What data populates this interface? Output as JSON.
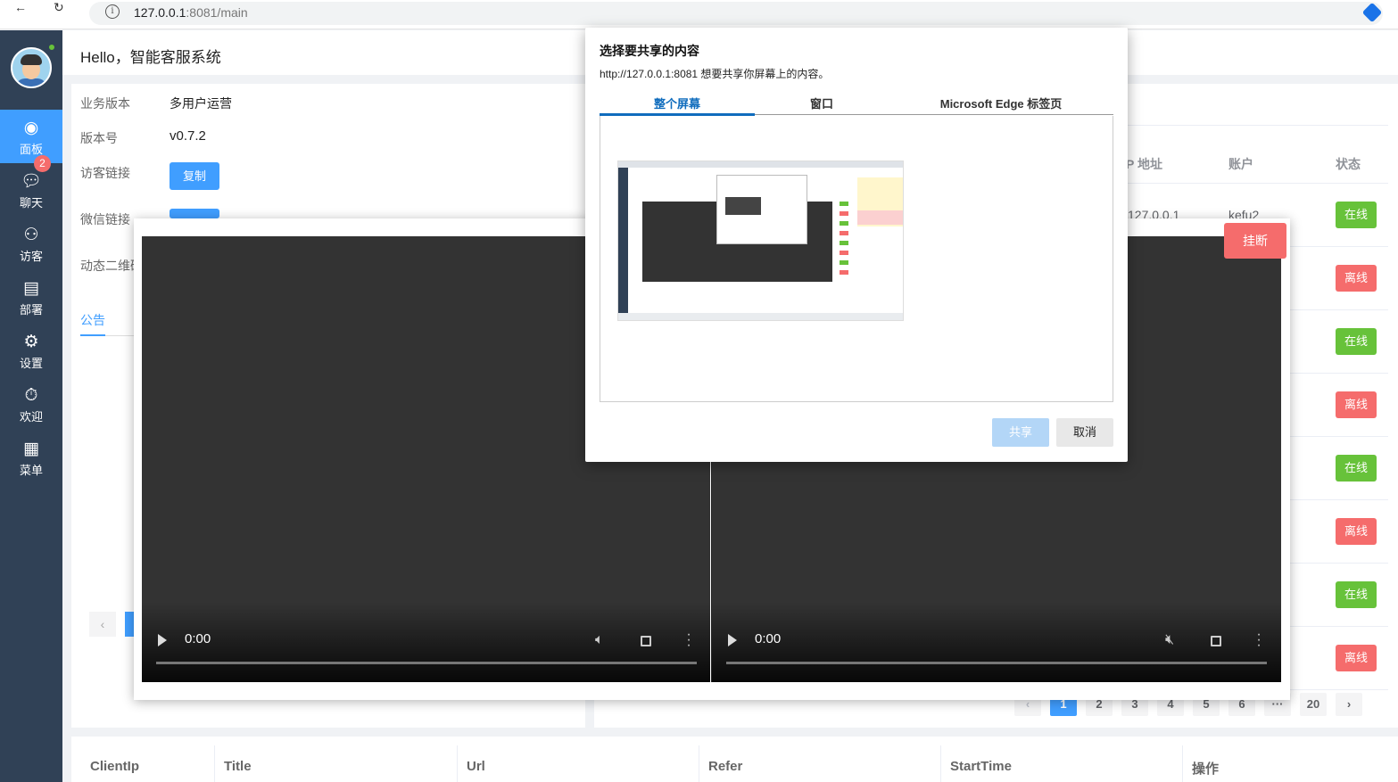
{
  "browser": {
    "url_host": "127.0.0.1",
    "url_rest": ":8081/main",
    "back_icon": "arrow-left-icon",
    "reload_icon": "reload-icon"
  },
  "sidebar": {
    "chat_badge": "2",
    "items": [
      {
        "label": "面板",
        "icon": "dashboard-icon",
        "active": true
      },
      {
        "label": "聊天",
        "icon": "chat-icon"
      },
      {
        "label": "访客",
        "icon": "user-icon"
      },
      {
        "label": "部署",
        "icon": "document-icon"
      },
      {
        "label": "设置",
        "icon": "gear-icon"
      },
      {
        "label": "欢迎",
        "icon": "timer-icon"
      },
      {
        "label": "菜单",
        "icon": "grid-icon"
      }
    ]
  },
  "header": {
    "title": "Hello，智能客服系统"
  },
  "info": {
    "business_version_label": "业务版本",
    "business_version_value": "多用户运营",
    "version_label": "版本号",
    "version_value": "v0.7.2",
    "visitor_link_label": "访客链接",
    "copy_button": "复制",
    "wechat_link_label": "微信链接",
    "qrcode_label": "动态二维码",
    "notice_tab": "公告"
  },
  "agents_table": {
    "headers": [
      "P 地址",
      "账户",
      "状态"
    ],
    "first_row_ip": "127.0.0.1",
    "first_row_account": "kefu2",
    "statuses": [
      "在线",
      "离线",
      "在线",
      "离线",
      "在线",
      "离线",
      "在线",
      "离线"
    ]
  },
  "pagination": {
    "pages": [
      "1",
      "2",
      "3",
      "4",
      "5",
      "6",
      "···",
      "20"
    ],
    "current": "1"
  },
  "bottom_table": {
    "headers": [
      "ClientIp",
      "Title",
      "Url",
      "Refer",
      "StartTime",
      "操作"
    ]
  },
  "video_call": {
    "hangup_label": "挂断",
    "left_time": "0:00",
    "right_time": "0:00"
  },
  "share_dialog": {
    "title": "选择要共享的内容",
    "description": "http://127.0.0.1:8081 想要共享你屏幕上的内容。",
    "tabs": [
      "整个屏幕",
      "窗口",
      "Microsoft Edge 标签页"
    ],
    "active_tab": "整个屏幕",
    "share_button": "共享",
    "cancel_button": "取消"
  },
  "colors": {
    "sidebar": "#304156",
    "primary": "#409eff",
    "online": "#67c23a",
    "offline": "#f56c6c"
  }
}
